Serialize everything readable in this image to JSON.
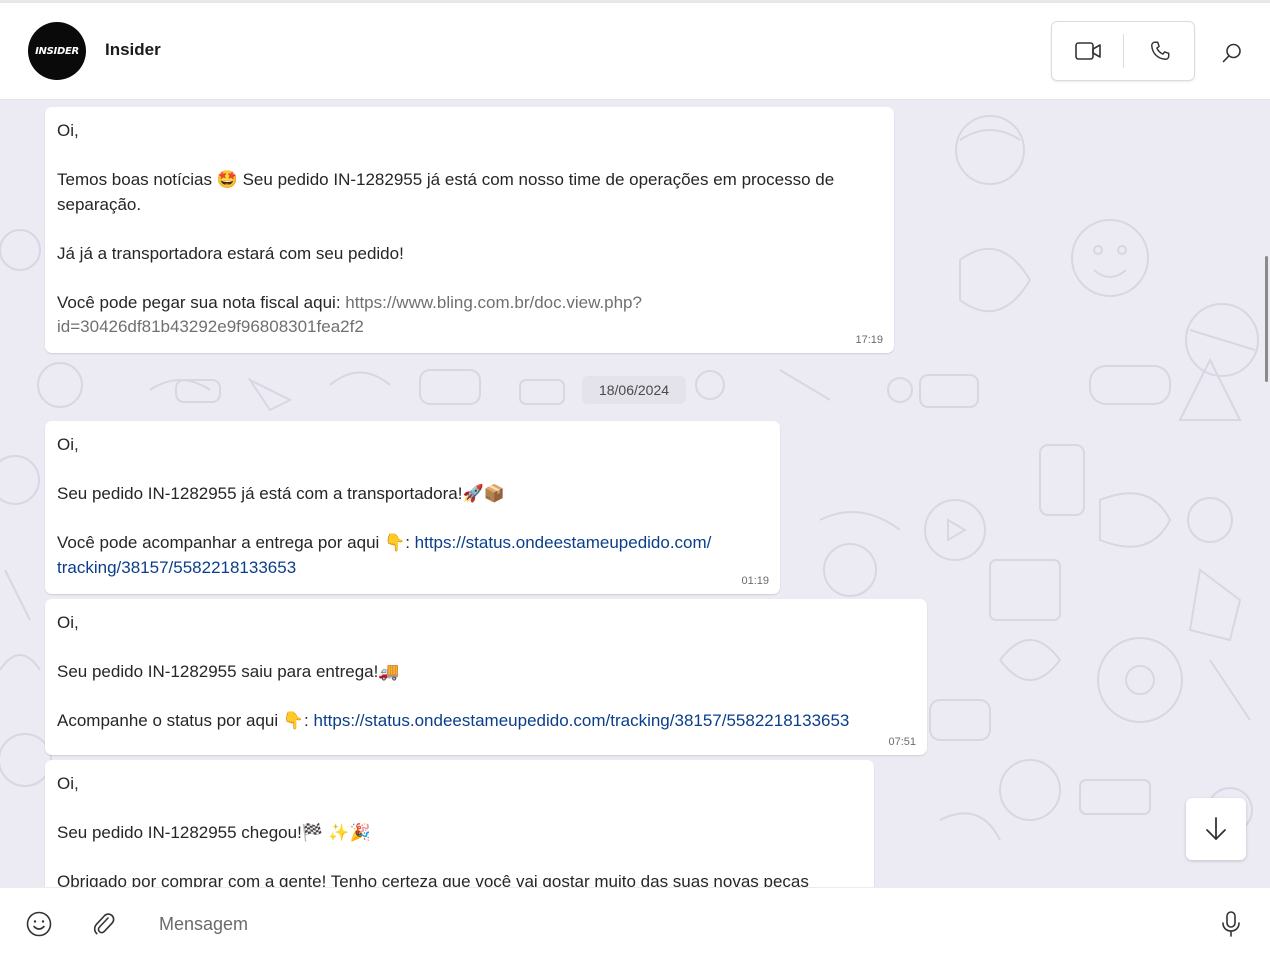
{
  "header": {
    "avatar_text": "INSIDER",
    "contact_name": "Insider",
    "video_icon": "video-camera-icon",
    "voice_icon": "phone-icon",
    "search_icon": "search-icon"
  },
  "chat": {
    "date_separator": "18/06/2024",
    "messages": [
      {
        "greeting": "Oi,",
        "line1a": "Temos boas notícias ",
        "line1_emoji": "🤩",
        "line1b": " Seu pedido IN-1282955 já está com nosso time de operações em processo de",
        "line1c": "separação.",
        "line2": "Já já a transportadora estará com seu pedido!",
        "line3_prefix": "Você pode pegar sua nota fiscal aqui: ",
        "link_part1": "https://www.bling.com.br/doc.view.php?",
        "link_part2": "id=30426df81b43292e9f96808301fea2f2",
        "time": "17:19"
      },
      {
        "greeting": "Oi,",
        "line1": "Seu pedido IN-1282955 já está com a transportadora!",
        "line1_emoji": "🚀📦",
        "line2_prefix": "Você pode acompanhar a entrega por aqui ",
        "line2_emoji": "👇",
        "line2_colon": ": ",
        "link_part1": "https://status.ondeestameupedido.com/",
        "link_part2": "tracking/38157/5582218133653",
        "time": "01:19"
      },
      {
        "greeting": "Oi,",
        "line1": "Seu pedido IN-1282955 saiu para entrega!",
        "line1_emoji": "🚚",
        "line2_prefix": "Acompanhe o status por aqui ",
        "line2_emoji": "👇",
        "line2_colon": ": ",
        "link": "https://status.ondeestameupedido.com/tracking/38157/5582218133653",
        "time": "07:51"
      },
      {
        "greeting": "Oi,",
        "line1": "Seu pedido IN-1282955 chegou!",
        "line1_emoji": "🏁 ✨🎉",
        "line2": "Obrigado por comprar com a gente! Tenho certeza que você vai gostar muito das suas novas peças"
      }
    ]
  },
  "scroll_down_icon": "arrow-down-icon",
  "composer": {
    "emoji_icon": "emoji-smile-icon",
    "attach_icon": "paperclip-icon",
    "placeholder": "Mensagem",
    "mic_icon": "microphone-icon"
  }
}
